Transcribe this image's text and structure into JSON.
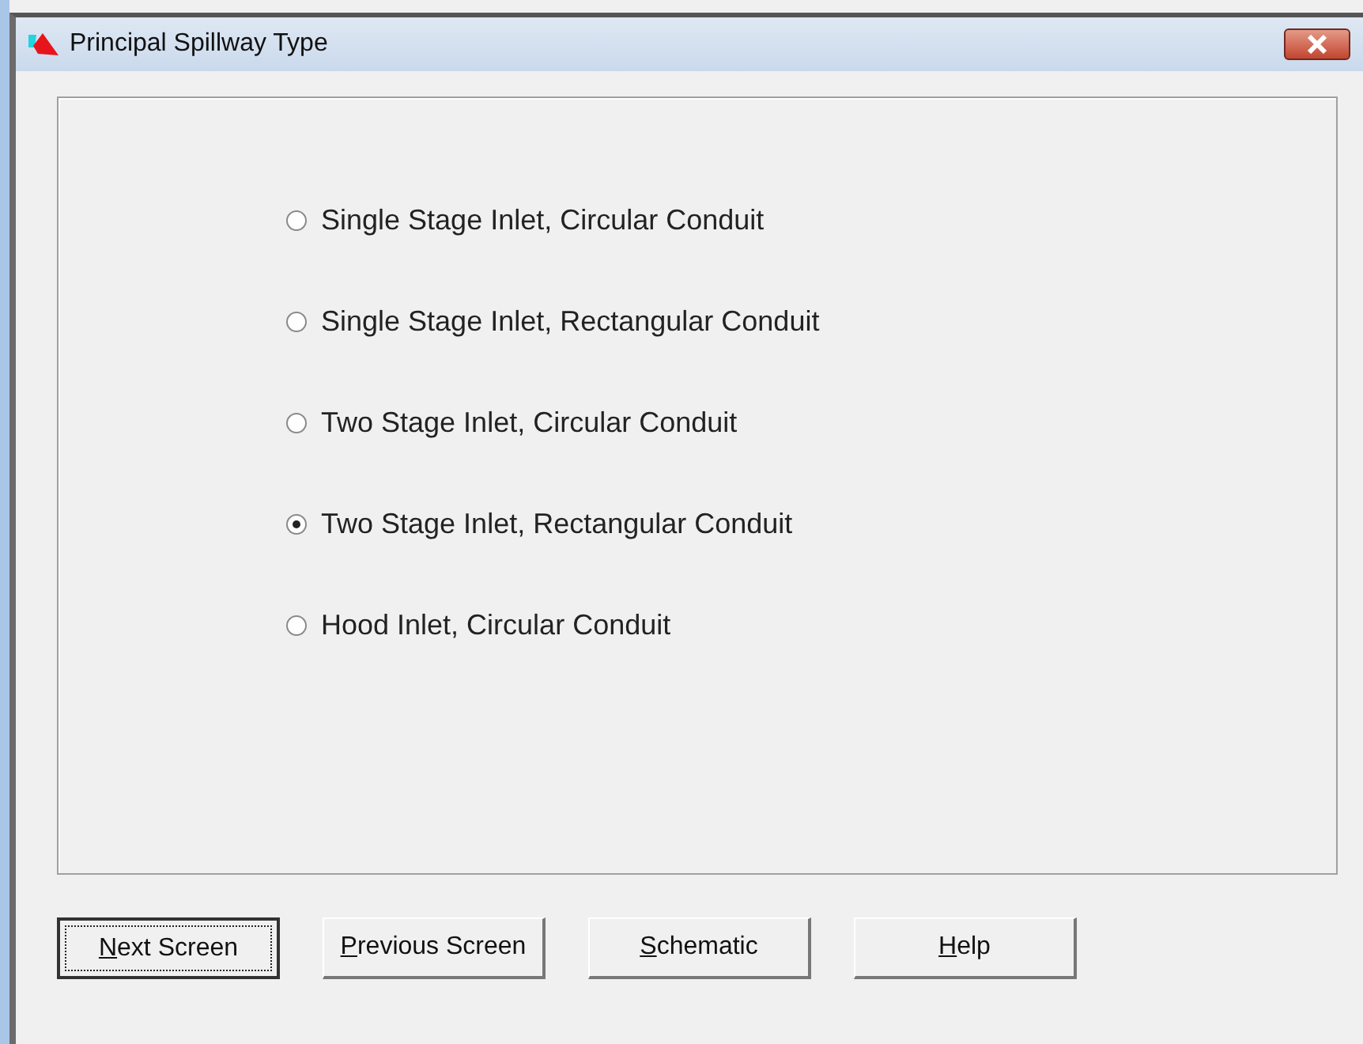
{
  "window": {
    "title": "Principal Spillway Type"
  },
  "options": [
    {
      "label": "Single Stage Inlet, Circular Conduit",
      "selected": false
    },
    {
      "label": "Single Stage Inlet, Rectangular Conduit",
      "selected": false
    },
    {
      "label": "Two Stage Inlet, Circular Conduit",
      "selected": false
    },
    {
      "label": "Two Stage Inlet, Rectangular Conduit",
      "selected": true
    },
    {
      "label": "Hood Inlet, Circular Conduit",
      "selected": false
    }
  ],
  "buttons": [
    {
      "access_key": "N",
      "label_rest": "ext Screen",
      "default": true
    },
    {
      "access_key": "P",
      "label_rest": "revious Screen",
      "default": false
    },
    {
      "access_key": "S",
      "label_rest": "chematic",
      "default": false
    },
    {
      "access_key": "H",
      "label_rest": "elp",
      "default": false
    }
  ]
}
